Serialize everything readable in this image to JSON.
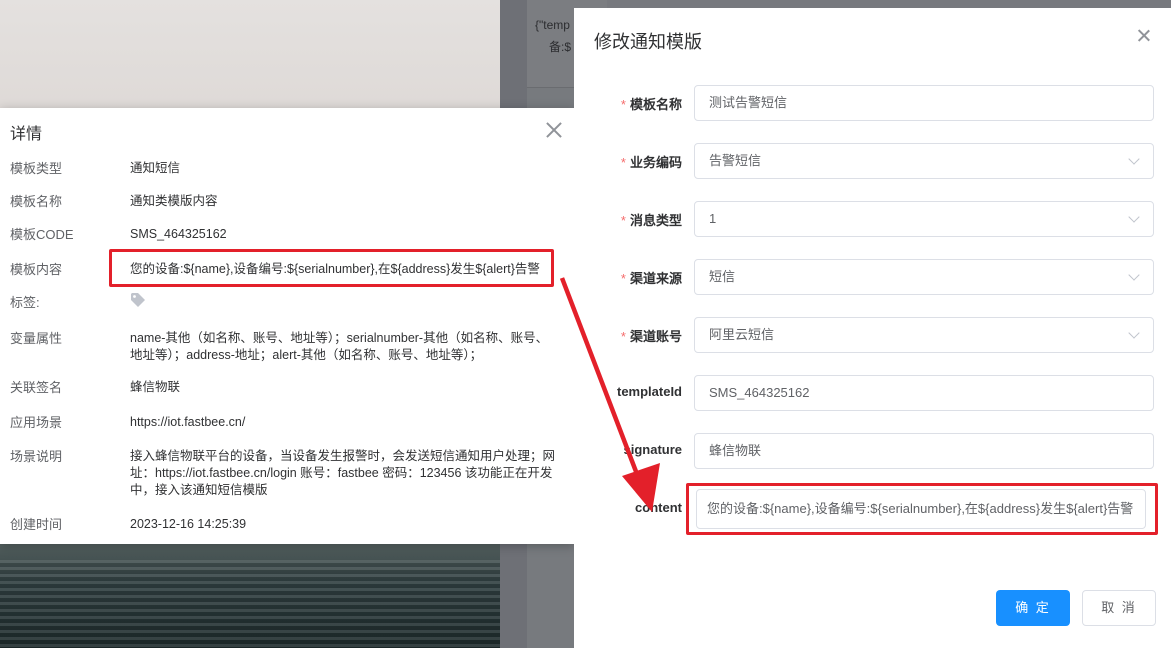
{
  "background": {
    "table_snippet_line1": "{\"temp",
    "table_snippet_line2": "备:$"
  },
  "detail_dialog": {
    "title": "详情",
    "rows": [
      {
        "label": "模板类型",
        "value": "通知短信"
      },
      {
        "label": "模板名称",
        "value": "通知类模版内容"
      },
      {
        "label": "模板CODE",
        "value": "SMS_464325162"
      },
      {
        "label": "模板内容",
        "value": "您的设备:${name},设备编号:${serialnumber},在${address}发生${alert}告警"
      },
      {
        "label": "标签:",
        "value": ""
      },
      {
        "label": "变量属性",
        "value": "name-其他（如名称、账号、地址等）；serialnumber-其他（如名称、账号、地址等）；address-地址；alert-其他（如名称、账号、地址等）；"
      },
      {
        "label": "关联签名",
        "value": "蜂信物联"
      },
      {
        "label": "应用场景",
        "value": "https://iot.fastbee.cn/"
      },
      {
        "label": "场景说明",
        "value": "接入蜂信物联平台的设备，当设备发生报警时，会发送短信通知用户处理；网址：https://iot.fastbee.cn/login 账号：fastbee 密码：123456 该功能正在开发中，接入该通知短信模版"
      },
      {
        "label": "创建时间",
        "value": "2023-12-16 14:25:39"
      }
    ]
  },
  "edit_dialog": {
    "title": "修改通知模版",
    "fields": [
      {
        "label": "模板名称",
        "required": true,
        "value": "测试告警短信",
        "type": "text"
      },
      {
        "label": "业务编码",
        "required": true,
        "value": "告警短信",
        "type": "select"
      },
      {
        "label": "消息类型",
        "required": true,
        "value": "1",
        "type": "select"
      },
      {
        "label": "渠道来源",
        "required": true,
        "value": "短信",
        "type": "select"
      },
      {
        "label": "渠道账号",
        "required": true,
        "value": "阿里云短信",
        "type": "select"
      },
      {
        "label": "templateId",
        "required": false,
        "value": "SMS_464325162",
        "type": "text"
      },
      {
        "label": "signature",
        "required": false,
        "value": "蜂信物联",
        "type": "text"
      },
      {
        "label": "content",
        "required": false,
        "value": "您的设备:${name},设备编号:${serialnumber},在${address}发生${alert}告警",
        "type": "text"
      }
    ],
    "required_mark": "*",
    "confirm_label": "确 定",
    "cancel_label": "取 消"
  },
  "colors": {
    "highlight": "#e3202a",
    "primary": "#1890ff",
    "required": "#f56c6c"
  }
}
